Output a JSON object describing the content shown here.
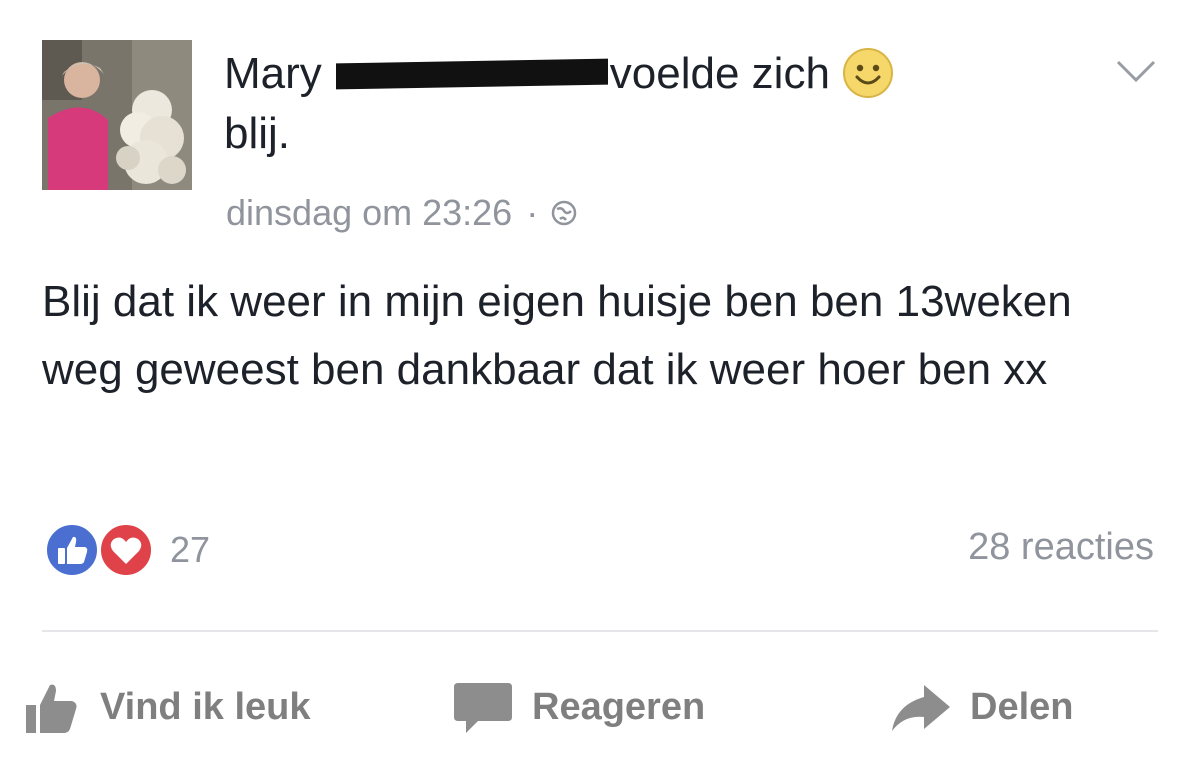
{
  "post": {
    "author": "Mary",
    "feeling_text": "voelde zich",
    "feeling_suffix": "blij.",
    "feeling_icon": "smiley-icon",
    "timestamp": "dinsdag om 23:26",
    "separator": "·",
    "privacy_icon": "globe-icon",
    "body": "Blij dat ik weer in mijn eigen huisje ben ben 13weken weg geweest ben dankbaar dat ik weer hoer ben xx"
  },
  "reactions": {
    "count": "27",
    "icons": [
      "like-reaction-icon",
      "love-reaction-icon"
    ],
    "comments_label": "28 reacties"
  },
  "actions": {
    "like_label": "Vind ik leuk",
    "comment_label": "Reageren",
    "share_label": "Delen"
  },
  "colors": {
    "like_blue": "#4a6fd0",
    "love_red": "#e0424a",
    "meta_gray": "#90949c",
    "action_gray": "#7f7f7f"
  }
}
